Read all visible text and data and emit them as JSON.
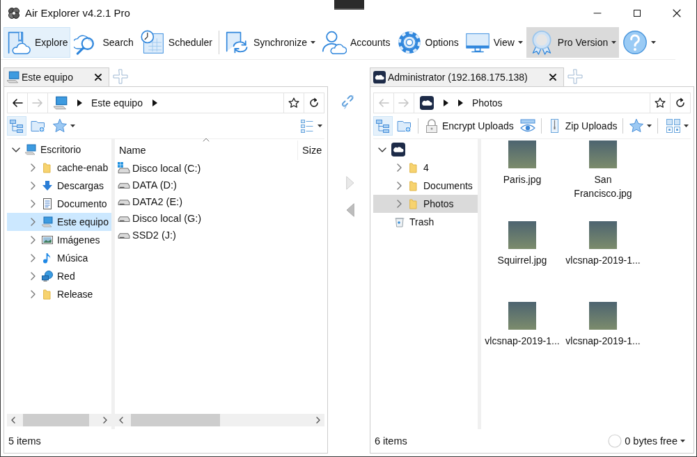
{
  "window": {
    "title": "Air Explorer v4.2.1 Pro"
  },
  "toolbar": {
    "items": [
      {
        "kind": "explore",
        "label": "Explore",
        "selected": true,
        "hovered": false,
        "dropdown": false
      },
      {
        "kind": "search",
        "label": "Search",
        "selected": false,
        "hovered": false,
        "dropdown": false
      },
      {
        "kind": "scheduler",
        "label": "Scheduler",
        "selected": false,
        "hovered": false,
        "dropdown": false
      },
      {
        "kind": "divider"
      },
      {
        "kind": "sync",
        "label": "Synchronize",
        "selected": false,
        "hovered": false,
        "dropdown": true
      },
      {
        "kind": "accounts",
        "label": "Accounts",
        "selected": false,
        "hovered": false,
        "dropdown": false
      },
      {
        "kind": "options",
        "label": "Options",
        "selected": false,
        "hovered": false,
        "dropdown": false
      },
      {
        "kind": "view",
        "label": "View",
        "selected": false,
        "hovered": false,
        "dropdown": true
      },
      {
        "kind": "pro",
        "label": "Pro Version",
        "selected": false,
        "hovered": true,
        "dropdown": true
      },
      {
        "kind": "help",
        "selected": false,
        "hovered": false,
        "dropdown": true
      }
    ]
  },
  "panes": [
    {
      "kind": "local",
      "focused": true,
      "tab": {
        "label": "Este equipo"
      },
      "nav": {
        "back_disabled": false,
        "forward_disabled": true,
        "crumbs": [
          {
            "kind": "sep"
          },
          {
            "kind": "text",
            "label": "Este equipo"
          },
          {
            "kind": "sep"
          }
        ]
      },
      "tools": [
        {
          "kind": "tree",
          "on": true,
          "dropdown": false
        },
        {
          "kind": "newfolder",
          "on": false,
          "dropdown": false
        },
        {
          "kind": "star",
          "on": false,
          "dropdown": true
        },
        {
          "kind": "viewlist",
          "on": false,
          "dropdown": true
        }
      ],
      "tree": [
        {
          "label": "Escritorio",
          "kind": "computer",
          "expandable": true,
          "expanded": true,
          "selected": false,
          "children": [
            {
              "label": "cache-enab",
              "kind": "folder",
              "expandable": true,
              "expanded": false,
              "selected": false
            },
            {
              "label": "Descargas",
              "kind": "download",
              "expandable": true,
              "expanded": false,
              "selected": false
            },
            {
              "label": "Documento",
              "kind": "document",
              "expandable": true,
              "expanded": false,
              "selected": false
            },
            {
              "label": "Este equipo",
              "kind": "computer",
              "expandable": true,
              "expanded": false,
              "selected": true
            },
            {
              "label": "Imágenes",
              "kind": "pictures",
              "expandable": true,
              "expanded": false,
              "selected": false
            },
            {
              "label": "Música",
              "kind": "music",
              "expandable": true,
              "expanded": false,
              "selected": false
            },
            {
              "label": "Red",
              "kind": "network",
              "expandable": true,
              "expanded": false,
              "selected": false
            },
            {
              "label": "Release",
              "kind": "folder",
              "expandable": true,
              "expanded": false,
              "selected": false
            }
          ]
        }
      ],
      "columns": [
        {
          "label": "Name",
          "sorted": true
        },
        {
          "label": "Size",
          "sorted": false
        }
      ],
      "files": [
        {
          "name": "Disco local (C:)",
          "kind": "windrive"
        },
        {
          "name": "DATA (D:)",
          "kind": "drive"
        },
        {
          "name": "DATA2 (E:)",
          "kind": "drive"
        },
        {
          "name": "Disco local (G:)",
          "kind": "drive"
        },
        {
          "name": "SSD2 (J:)",
          "kind": "drive"
        }
      ],
      "status": "5 items"
    },
    {
      "kind": "cloud",
      "focused": false,
      "tab": {
        "label": "Administrator (192.168.175.138)"
      },
      "nav": {
        "back_disabled": true,
        "forward_disabled": true,
        "crumbs": [
          {
            "kind": "sep"
          },
          {
            "kind": "sep"
          },
          {
            "kind": "text",
            "label": "Photos"
          }
        ]
      },
      "tools": [
        {
          "kind": "tree",
          "on": true,
          "dropdown": false
        },
        {
          "kind": "newfolder",
          "on": false,
          "dropdown": false
        },
        {
          "kind": "divider"
        },
        {
          "kind": "lock",
          "label": "Encrypt Uploads",
          "on": false,
          "dropdown": false
        },
        {
          "kind": "eye",
          "on": false,
          "dropdown": false
        },
        {
          "kind": "divider"
        },
        {
          "kind": "zip",
          "label": "Zip Uploads",
          "on": false,
          "dropdown": false
        },
        {
          "kind": "divider"
        },
        {
          "kind": "star",
          "on": false,
          "dropdown": true
        },
        {
          "kind": "divider"
        },
        {
          "kind": "viewgrid",
          "on": false,
          "dropdown": true
        }
      ],
      "tree": [
        {
          "kind": "cloud",
          "expandable": true,
          "expanded": true,
          "selected": false,
          "children": [
            {
              "label": "4",
              "kind": "folder",
              "expandable": true,
              "expanded": false,
              "selected": false
            },
            {
              "label": "Documents",
              "kind": "folder",
              "expandable": true,
              "expanded": false,
              "selected": false
            },
            {
              "label": "Photos",
              "kind": "folder",
              "expandable": true,
              "expanded": false,
              "selected": true
            },
            {
              "label": "Trash",
              "kind": "trash",
              "expandable": false,
              "selected": false
            }
          ]
        }
      ],
      "thumbnails": [
        {
          "name": "Paris.jpg"
        },
        {
          "name": "San Francisco.jpg"
        },
        {
          "name": "Squirrel.jpg"
        },
        {
          "name": "vlcsnap-2019-1..."
        },
        {
          "name": "vlcsnap-2019-1..."
        },
        {
          "name": "vlcsnap-2019-1..."
        }
      ],
      "status": "6 items",
      "free_space": "0 bytes free"
    }
  ]
}
